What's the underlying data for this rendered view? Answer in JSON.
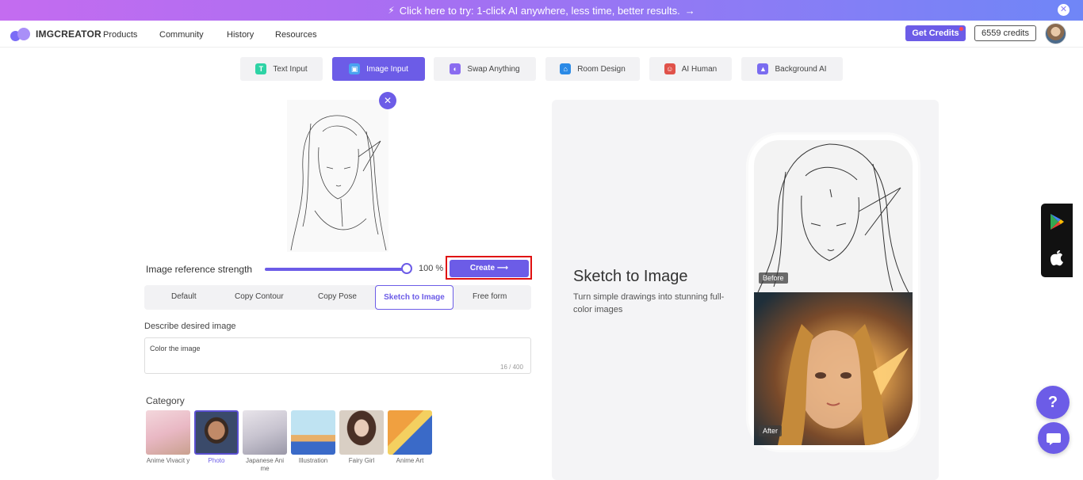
{
  "banner": {
    "text": "Click here to try: 1-click AI anywhere, less time, better results.",
    "arrow": "→",
    "close": "✕"
  },
  "nav": {
    "logo": "IMGCREATOR",
    "items": [
      "Products",
      "Community",
      "History",
      "Resources"
    ],
    "get_credits": "Get Credits",
    "credits": "6559 credits"
  },
  "tabs": [
    {
      "label": "Text Input",
      "icon": "text-input-icon",
      "color": "#2ed3a5",
      "glyph": "T"
    },
    {
      "label": "Image Input",
      "icon": "image-input-icon",
      "color": "#4aa3f0",
      "glyph": "▣",
      "active": true
    },
    {
      "label": "Swap Anything",
      "icon": "swap-icon",
      "color": "#8a6cf0",
      "glyph": "◐"
    },
    {
      "label": "Room Design",
      "icon": "house-icon",
      "color": "#2b8ae6",
      "glyph": "⌂"
    },
    {
      "label": "AI Human",
      "icon": "human-icon",
      "color": "#e0524a",
      "glyph": "☺"
    },
    {
      "label": "Background AI",
      "icon": "landscape-icon",
      "color": "#7a6cf0",
      "glyph": "▲"
    }
  ],
  "editor": {
    "strength_label": "Image reference strength",
    "strength_value": "100 %",
    "strength_level": 1.0,
    "create_label": "Create ⟶",
    "modes": [
      "Default",
      "Copy Contour",
      "Copy Pose",
      "Sketch to Image",
      "Free form"
    ],
    "active_mode": "Sketch to Image",
    "describe_label": "Describe desired image",
    "prompt_value": "Color the image",
    "counter": "16 / 400",
    "category_label": "Category",
    "categories": [
      {
        "label": "Anime Vivacit y",
        "colors": [
          "#f3d7dc",
          "#c9a08e"
        ]
      },
      {
        "label": "Photo",
        "colors": [
          "#3a4a6a",
          "#b07a5a"
        ],
        "active": true
      },
      {
        "label": "Japanese Ani me",
        "colors": [
          "#e8e4ea",
          "#9a98a8"
        ]
      },
      {
        "label": "Illustration",
        "colors": [
          "#bfe3f2",
          "#e8b06a"
        ]
      },
      {
        "label": "Fairy Girl",
        "colors": [
          "#d9cfc4",
          "#6a4a3a"
        ]
      },
      {
        "label": "Anime Art",
        "colors": [
          "#f0a040",
          "#3a6ac8"
        ]
      }
    ]
  },
  "preview": {
    "title": "Sketch to Image",
    "description": "Turn simple drawings into stunning full-color images",
    "before_tag": "Before",
    "after_tag": "After"
  },
  "float": {
    "help": "?"
  },
  "colors": {
    "accent": "#6c5ce7",
    "highlight": "#e01010"
  }
}
